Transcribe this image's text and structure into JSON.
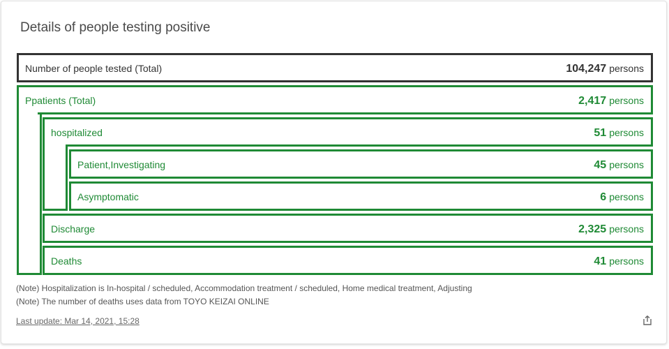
{
  "card": {
    "title": "Details of people testing positive",
    "rows": {
      "total_tested": {
        "label": "Number of people tested (Total)",
        "value": "104,247",
        "unit": "persons"
      },
      "patients_total": {
        "label": "Ppatients (Total)",
        "value": "2,417",
        "unit": "persons"
      },
      "hospitalized": {
        "label": "hospitalized",
        "value": "51",
        "unit": "persons"
      },
      "investigating": {
        "label": "Patient,Investigating",
        "value": "45",
        "unit": "persons"
      },
      "asymptomatic": {
        "label": "Asymptomatic",
        "value": "6",
        "unit": "persons"
      },
      "discharge": {
        "label": "Discharge",
        "value": "2,325",
        "unit": "persons"
      },
      "deaths": {
        "label": "Deaths",
        "value": "41",
        "unit": "persons"
      }
    },
    "notes": [
      "(Note) Hospitalization is In-hospital / scheduled, Accommodation treatment / scheduled, Home medical treatment, Adjusting",
      "(Note) The number of deaths uses data from TOYO KEIZAI ONLINE"
    ],
    "last_update": "Last update: Mar 14, 2021, 15:28",
    "share_icon": "share-icon"
  },
  "colors": {
    "accent_green": "#1f8a35",
    "total_border": "#333333"
  }
}
